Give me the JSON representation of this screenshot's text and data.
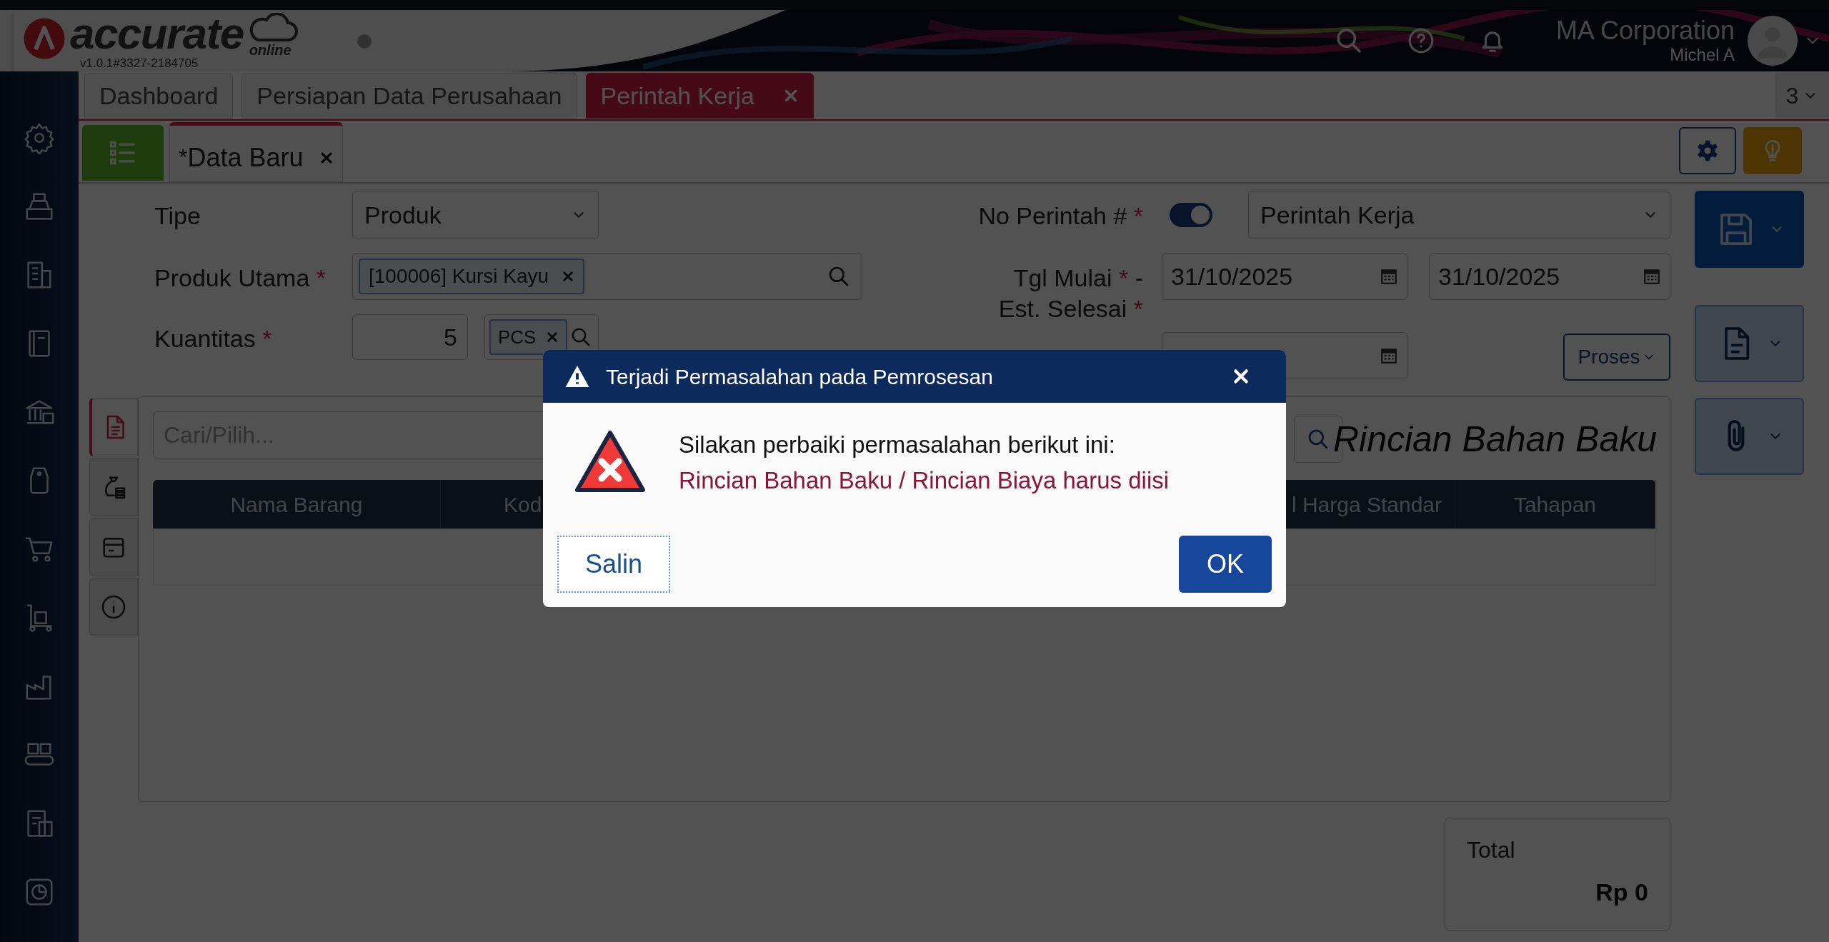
{
  "header": {
    "logo_text": "accurate",
    "logo_subtext": "online",
    "version": "v1.0.1#3327-2184705",
    "company": "MA Corporation",
    "user": "Michel A"
  },
  "tabs": [
    {
      "label": "Dashboard",
      "selected": false,
      "closable": false
    },
    {
      "label": "Persiapan Data Perusahaan",
      "selected": false,
      "closable": false
    },
    {
      "label": "Perintah Kerja",
      "selected": true,
      "closable": true
    }
  ],
  "tab_overflow_count": "3",
  "document_tab": {
    "label": "Data Baru",
    "modified_mark": "*"
  },
  "form": {
    "tipe": {
      "label": "Tipe",
      "value": "Produk"
    },
    "produk_utama": {
      "label": "Produk Utama",
      "required_mark": "*",
      "chip": "[100006] Kursi Kayu"
    },
    "kuantitas": {
      "label": "Kuantitas",
      "required_mark": "*",
      "value": "5",
      "unit_chip": "PCS"
    },
    "no_perintah": {
      "label": "No Perintah #",
      "required_mark": "*",
      "auto_number": true,
      "value": "Perintah Kerja"
    },
    "tgl_mulai": {
      "label": "Tgl Mulai",
      "required_mark": "*",
      "separator": "-",
      "value": "31/10/2025"
    },
    "est_selesai": {
      "label": "Est. Selesai",
      "required_mark": "*",
      "value": "31/10/2025"
    },
    "proses_button": "Proses"
  },
  "detail": {
    "side_tabs": [
      {
        "selected": true
      },
      {
        "selected": false
      },
      {
        "selected": false
      },
      {
        "selected": false
      }
    ],
    "search_placeholder": "Cari/Pilih...",
    "title": "Rincian Bahan Baku",
    "columns": [
      "Nama Barang",
      "Kod",
      "l Harga Standar",
      "Tahapan"
    ]
  },
  "total": {
    "label": "Total",
    "value": "Rp 0"
  },
  "dialog": {
    "title": "Terjadi Permasalahan pada Pemrosesan",
    "message": "Silakan perbaiki permasalahan berikut ini:",
    "error": "Rincian Bahan Baku / Rincian Biaya harus diisi",
    "buttons": [
      {
        "label": "Salin",
        "kind": "secondary"
      },
      {
        "label": "OK",
        "kind": "primary"
      }
    ]
  }
}
